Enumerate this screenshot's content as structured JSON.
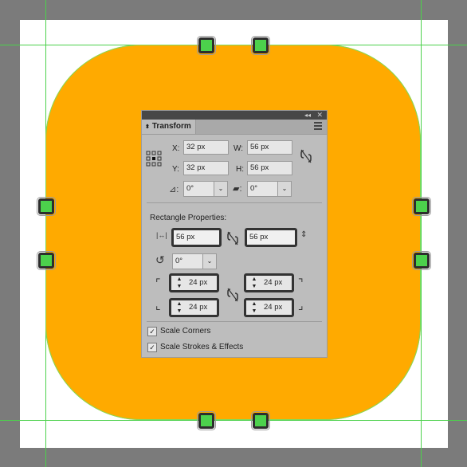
{
  "panel": {
    "tab_title": "Transform",
    "collapse_icon": "◂◂",
    "close_icon": "✕",
    "x_label": "X:",
    "x_value": "32 px",
    "y_label": "Y:",
    "y_value": "32 px",
    "w_label": "W:",
    "w_value": "56 px",
    "h_label": "H:",
    "h_value": "56 px",
    "rotate_value": "0°",
    "shear_value": "0°",
    "section_title": "Rectangle Properties:",
    "rect_width": "56 px",
    "rect_height": "56 px",
    "corner_rotation": "0°",
    "corner_tl": "24 px",
    "corner_tr": "24 px",
    "corner_bl": "24 px",
    "corner_br": "24 px",
    "scale_corners": "Scale Corners",
    "scale_strokes": "Scale Strokes & Effects"
  },
  "colors": {
    "shape_fill": "#ffaa00",
    "guide": "#4cd14c",
    "canvas_bg": "#7b7b7b"
  }
}
